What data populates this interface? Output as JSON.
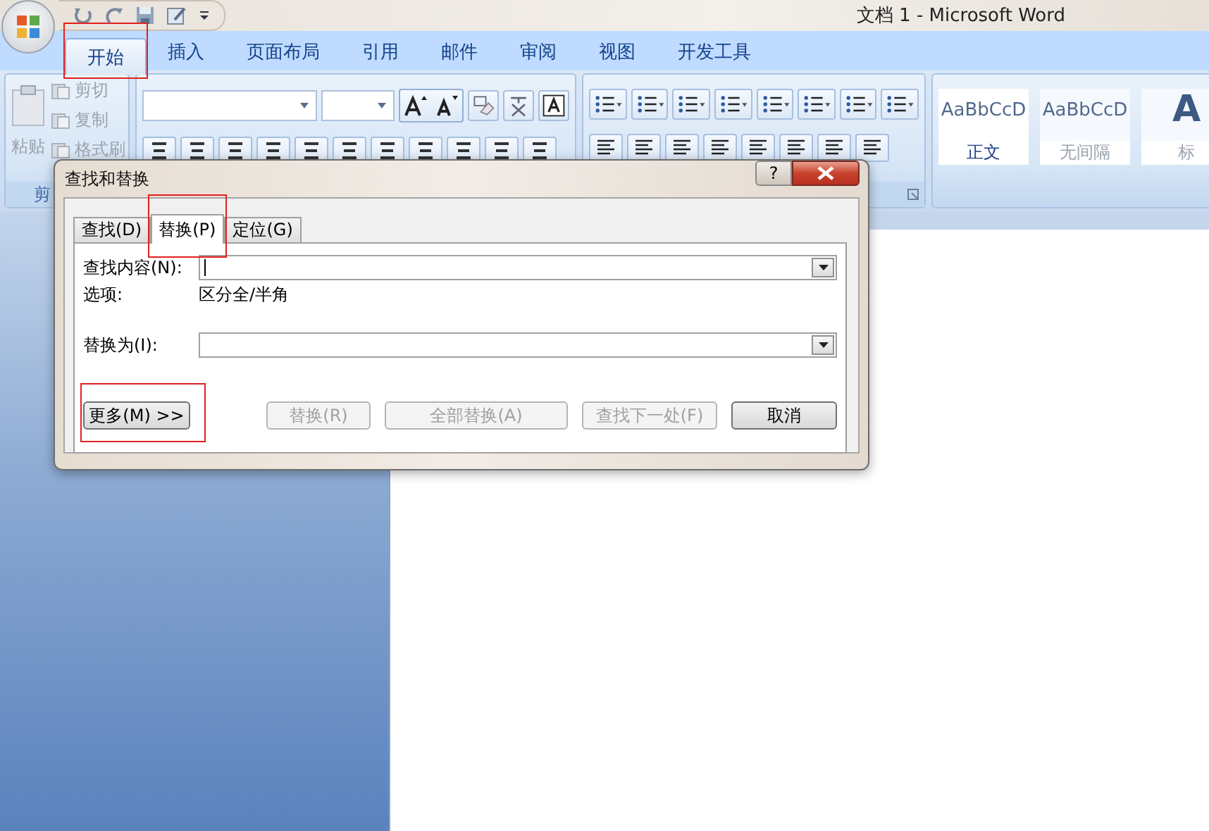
{
  "window": {
    "title": "文档 1 - Microsoft Word"
  },
  "ribbon_tabs": [
    {
      "label": "开始",
      "selected": true,
      "highlighted": true
    },
    {
      "label": "插入",
      "selected": false,
      "highlighted": false
    },
    {
      "label": "页面布局",
      "selected": false,
      "highlighted": false
    },
    {
      "label": "引用",
      "selected": false,
      "highlighted": false
    },
    {
      "label": "邮件",
      "selected": false,
      "highlighted": false
    },
    {
      "label": "审阅",
      "selected": false,
      "highlighted": false
    },
    {
      "label": "视图",
      "selected": false,
      "highlighted": false
    },
    {
      "label": "开发工具",
      "selected": false,
      "highlighted": false
    }
  ],
  "clipboard": {
    "paste": "粘贴",
    "group_label": "剪",
    "items": [
      {
        "label": "剪切",
        "disabled": true
      },
      {
        "label": "复制",
        "disabled": true
      },
      {
        "label": "格式刷",
        "disabled": true
      }
    ]
  },
  "styles": [
    {
      "preview": "AaBbCcD",
      "name": "正文",
      "selected": true
    },
    {
      "preview": "AaBbCcD",
      "name": "无间隔",
      "selected": false
    },
    {
      "preview": "A",
      "name": "标",
      "selected": false
    }
  ],
  "dialog": {
    "title": "查找和替换",
    "help": "?",
    "tabs": [
      {
        "label": "查找(D)",
        "selected": false,
        "highlighted": false
      },
      {
        "label": "替换(P)",
        "selected": true,
        "highlighted": true
      },
      {
        "label": "定位(G)",
        "selected": false,
        "highlighted": false
      }
    ],
    "find_label": "查找内容(N):",
    "options_label": "选项:",
    "options_value": "区分全/半角",
    "replace_label": "替换为(I):",
    "buttons": [
      {
        "label": "更多(M) >>",
        "disabled": false,
        "highlighted": true
      },
      {
        "label": "替换(R)",
        "disabled": true,
        "highlighted": false
      },
      {
        "label": "全部替换(A)",
        "disabled": true,
        "highlighted": false
      },
      {
        "label": "查找下一处(F)",
        "disabled": true,
        "highlighted": false
      },
      {
        "label": "取消",
        "disabled": false,
        "highlighted": false
      }
    ]
  }
}
